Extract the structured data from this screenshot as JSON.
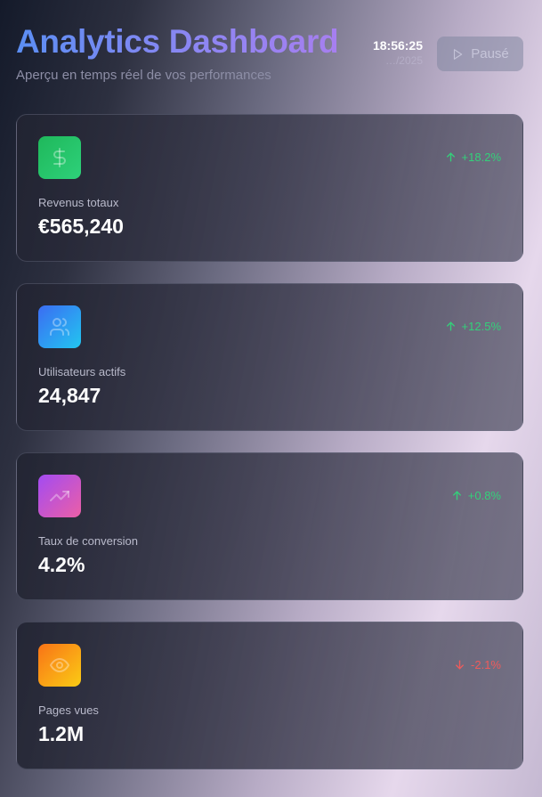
{
  "header": {
    "title": "Analytics Dashboard",
    "subtitle": "Aperçu en temps réel de vos performances",
    "time": "18:56:25",
    "date": "…/2025",
    "pause_label": "Pausé"
  },
  "colors": {
    "trend_up": "#33d17a",
    "trend_down": "#ef5b5b"
  },
  "metrics": [
    {
      "icon": "dollar-icon",
      "label": "Revenus totaux",
      "value": "€565,240",
      "change": "+18.2%",
      "direction": "up",
      "gradient": [
        "#1fb85b",
        "#2ed17a"
      ]
    },
    {
      "icon": "users-icon",
      "label": "Utilisateurs actifs",
      "value": "24,847",
      "change": "+12.5%",
      "direction": "up",
      "gradient": [
        "#3b6cf3",
        "#22c6f0"
      ]
    },
    {
      "icon": "trending-up-icon",
      "label": "Taux de conversion",
      "value": "4.2%",
      "change": "+0.8%",
      "direction": "up",
      "gradient": [
        "#a24bf2",
        "#ec5fa6"
      ]
    },
    {
      "icon": "eye-icon",
      "label": "Pages vues",
      "value": "1.2M",
      "change": "-2.1%",
      "direction": "down",
      "gradient": [
        "#f97316",
        "#facc15"
      ]
    }
  ]
}
